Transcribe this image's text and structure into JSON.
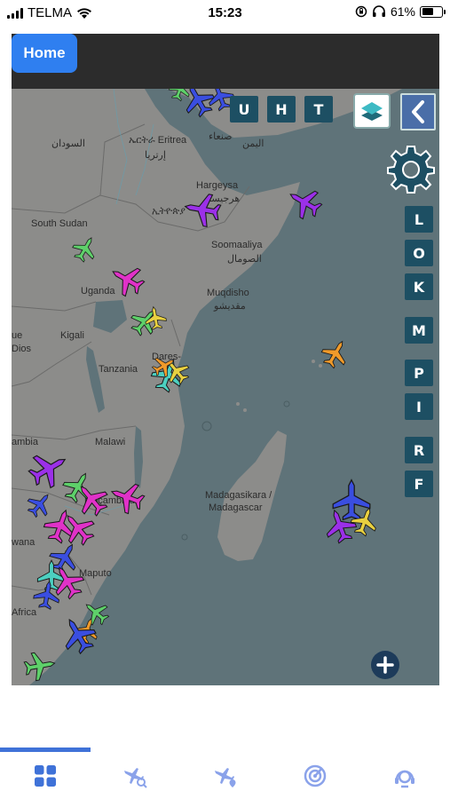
{
  "status_bar": {
    "carrier": "TELMA",
    "time": "15:23",
    "battery_percent": "61%",
    "battery_level": 0.61,
    "icons": [
      "signal-icon",
      "wifi-icon",
      "orientation-lock-icon",
      "headphones-icon",
      "battery-icon"
    ]
  },
  "header": {
    "home_label": "Home"
  },
  "map_controls": {
    "top_letters": [
      "U",
      "H",
      "T"
    ],
    "side_letters": [
      "L",
      "O",
      "K",
      "M",
      "P",
      "I",
      "R",
      "F"
    ],
    "icons": [
      "layers-icon",
      "chevron-left-icon",
      "gear-icon",
      "plus-icon"
    ]
  },
  "map_labels": {
    "sudan_ar": "السودان",
    "eritrea": "ኤርትራ Eritrea",
    "eritrea_ar": "إرتريا",
    "yemen_ar": "اليمن",
    "sanaa_ar": "صنعاء",
    "hargeysa": "Hargeysa",
    "hargeysa_ar": "هرجيسا",
    "ethiopia": "ኢትዮጵያ",
    "south_sudan": "South Sudan",
    "somaliya": "Soomaaliya",
    "somaliya_ar": "الصومال",
    "uganda": "Uganda",
    "muqdisho": "Muqdisho",
    "muqdisho_ar": "مقديشو",
    "kigali": "Kigali",
    "ue": "ue",
    "dios": "Dios",
    "tanzania": "Tanzania",
    "dares": "Dares-",
    "zambia": "ambia",
    "malawi": "Malawi",
    "madagasikara": "Madagasikara /",
    "madagascar": "Madagascar",
    "mocambique": "Moçambique",
    "maputo": "Maputo",
    "swana": "wana",
    "africa": "Africa"
  },
  "colors": {
    "map_water": "#5f7379",
    "map_land": "#8c8c8a",
    "header_bg": "#2c2c2c",
    "home_button": "#2f7ff0",
    "control_button": "#1d4f63",
    "nav_accent": "#3f72d8",
    "plane_purple": "#9b30e8",
    "plane_magenta": "#e032c8",
    "plane_blue": "#3a4ee0",
    "plane_green": "#5ed06a",
    "plane_orange": "#f09a2a",
    "plane_yellow": "#e8d040",
    "plane_teal": "#4ccfc0"
  },
  "bottom_nav": {
    "active_index": 0,
    "items": [
      "grid-icon",
      "flight-search-icon",
      "flight-location-icon",
      "radar-icon",
      "pilot-icon"
    ]
  }
}
